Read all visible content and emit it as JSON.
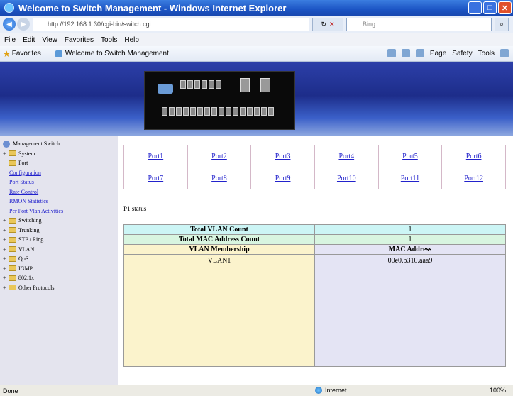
{
  "window": {
    "title": "Welcome to Switch Management - Windows Internet Explorer"
  },
  "address": {
    "url": "http://192.168.1.30/cgi-bin/switch.cgi",
    "search_placeholder": "Bing"
  },
  "menu": [
    "File",
    "Edit",
    "View",
    "Favorites",
    "Tools",
    "Help"
  ],
  "favorites": {
    "label": "Favorites",
    "tab_title": "Welcome to Switch Management"
  },
  "commands": [
    "Page",
    "Safety",
    "Tools"
  ],
  "tree": {
    "root": "Management Switch",
    "items": [
      {
        "label": "System",
        "type": "folder"
      },
      {
        "label": "Port",
        "type": "folder"
      },
      {
        "label": "Configuration",
        "type": "link"
      },
      {
        "label": "Port Status",
        "type": "link"
      },
      {
        "label": "Rate Control",
        "type": "link"
      },
      {
        "label": "RMON Statistics",
        "type": "link"
      },
      {
        "label": "Per Port Vlan Activities",
        "type": "link"
      },
      {
        "label": "Switching",
        "type": "folder"
      },
      {
        "label": "Trunking",
        "type": "folder"
      },
      {
        "label": "STP / Ring",
        "type": "folder"
      },
      {
        "label": "VLAN",
        "type": "folder"
      },
      {
        "label": "QoS",
        "type": "folder"
      },
      {
        "label": "IGMP",
        "type": "folder"
      },
      {
        "label": "802.1x",
        "type": "folder"
      },
      {
        "label": "Other Protocols",
        "type": "folder"
      }
    ]
  },
  "ports": {
    "row1": [
      "Port1",
      "Port2",
      "Port3",
      "Port4",
      "Port5",
      "Port6"
    ],
    "row2": [
      "Port7",
      "Port8",
      "Port9",
      "Port10",
      "Port11",
      "Port12"
    ]
  },
  "status_label": "P1 status",
  "stats": {
    "vlan_count_label": "Total VLAN Count",
    "vlan_count": "1",
    "mac_count_label": "Total MAC Address Count",
    "mac_count": "1",
    "membership_header": "VLAN Membership",
    "mac_header": "MAC Address",
    "membership_value": "VLAN1",
    "mac_value": "00e0.b310.aaa9"
  },
  "statusbar": {
    "left": "Done",
    "zone": "Internet",
    "zoom": "100%"
  }
}
